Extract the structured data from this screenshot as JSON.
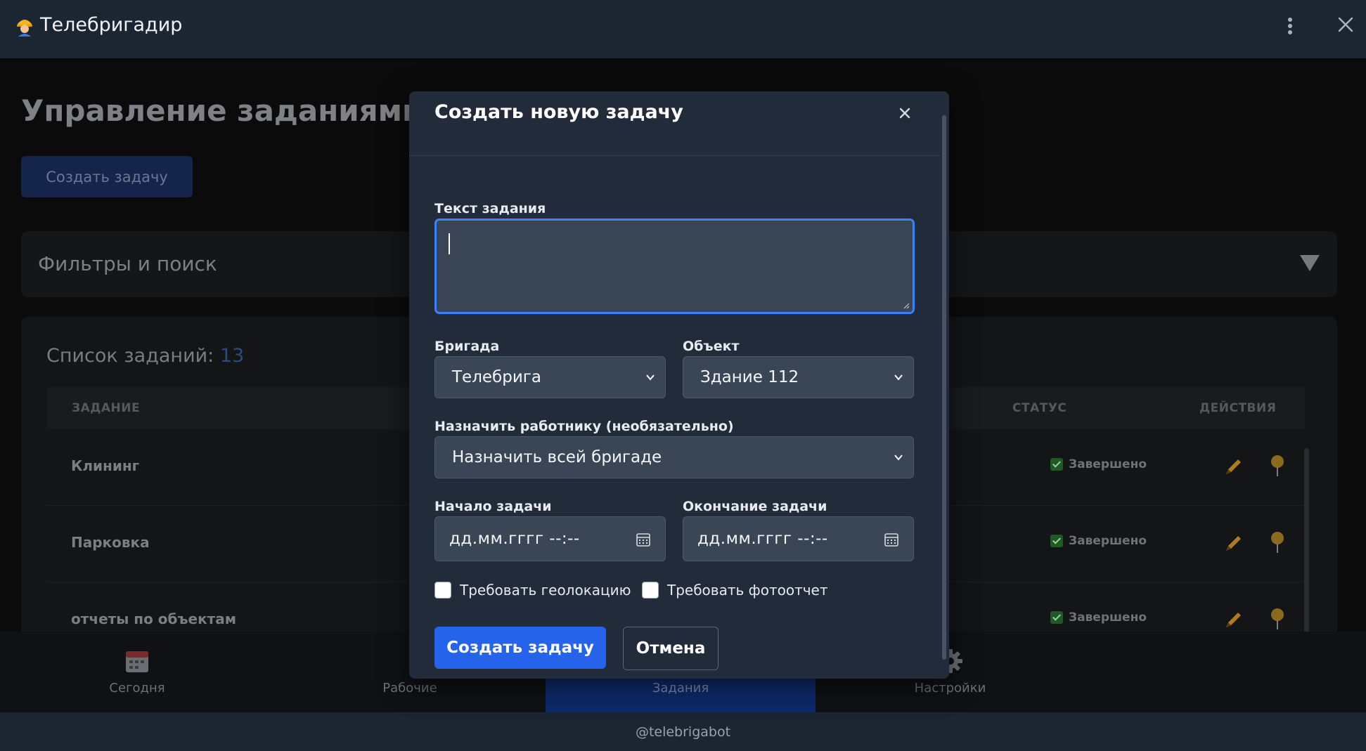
{
  "app": {
    "title": "Телебригадир"
  },
  "page": {
    "title": "Управление заданиями",
    "create_button": "Создать задачу",
    "filters_title": "Фильтры и поиск",
    "list_title": "Список заданий:",
    "list_count": "13",
    "columns": {
      "task": "ЗАДАНИЕ",
      "status": "СТАТУС",
      "actions": "ДЕЙСТВИЯ"
    },
    "rows": [
      {
        "task": "Клининг",
        "status": "Завершено"
      },
      {
        "task": "Парковка",
        "status": "Завершено"
      },
      {
        "task": "отчеты по объектам",
        "status": "Завершено"
      }
    ]
  },
  "bottom_nav": {
    "items": [
      {
        "label": "Сегодня",
        "icon": "calendar-icon"
      },
      {
        "label": "Рабочие",
        "icon": "workers-icon"
      },
      {
        "label": "Задания",
        "icon": "tasks-icon"
      },
      {
        "label": "Настройки",
        "icon": "gear-icon"
      }
    ],
    "active_index": 2
  },
  "footer": {
    "text": "@telebrigabot"
  },
  "modal": {
    "title": "Создать новую задачу",
    "task_text_label": "Текст задания",
    "task_text_value": "",
    "brigade_label": "Бригада",
    "brigade_value": "Телебрига",
    "object_label": "Объект",
    "object_value": "Здание 112",
    "assign_label": "Назначить работнику (необязательно)",
    "assign_value": "Назначить всей бригаде",
    "start_label": "Начало задачи",
    "start_value": "дд.мм.гггг --:--",
    "end_label": "Окончание задачи",
    "end_value": "дд.мм.гггг --:--",
    "require_geo_label": "Требовать геолокацию",
    "require_geo_checked": false,
    "require_photo_label": "Требовать фотоотчет",
    "require_photo_checked": false,
    "submit_label": "Создать задачу",
    "cancel_label": "Отмена"
  },
  "colors": {
    "accent": "#2563eb",
    "modal_bg": "#212b3a",
    "topbar_bg": "#1c2532",
    "input_bg": "#3a4556",
    "focus_border": "#3b82f6"
  }
}
